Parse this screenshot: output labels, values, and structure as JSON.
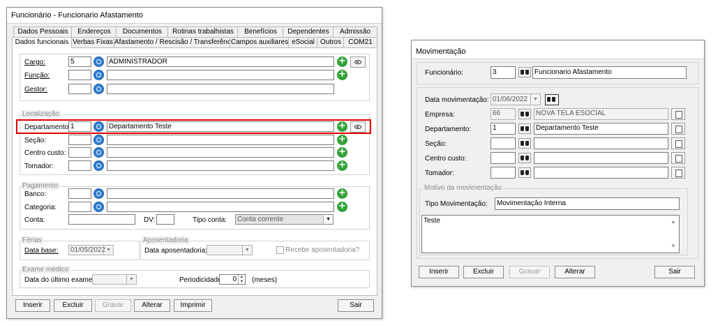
{
  "left_window": {
    "title": "Funcionário - Funcionario Afastamento",
    "tabs_row1": [
      "Dados Pessoais",
      "Endereços",
      "Documentos",
      "Rotinas trabalhistas",
      "Benefícios",
      "Dependentes",
      "Admissão"
    ],
    "tabs_row2": [
      "Dados funcionais",
      "Verbas Fixas",
      "Afastamento / Rescisão / Transferência",
      "Campos auxiliares",
      "eSocial",
      "Outros",
      "COM21"
    ],
    "active_tab": "Dados funcionais",
    "cargo": {
      "label": "Cargo:",
      "code": "5",
      "desc": "ADMINISTRADOR"
    },
    "funcao": {
      "label": "Função:",
      "code": "",
      "desc": ""
    },
    "gestor": {
      "label": "Gestor:",
      "code": "",
      "desc": ""
    },
    "localizacao": {
      "title": "Localização",
      "departamento": {
        "label": "Departamento:",
        "code": "1",
        "desc": "Departamento Teste"
      },
      "secao": {
        "label": "Seção:",
        "code": "",
        "desc": ""
      },
      "centro_custo": {
        "label": "Centro custo:",
        "code": "",
        "desc": ""
      },
      "tomador": {
        "label": "Tomador:",
        "code": "",
        "desc": ""
      }
    },
    "pagamento": {
      "title": "Pagamento",
      "banco": {
        "label": "Banco:",
        "code": "",
        "desc": ""
      },
      "categoria": {
        "label": "Categoria:",
        "code": "",
        "desc": ""
      },
      "conta_label": "Conta:",
      "conta": "",
      "dv_label": "DV:",
      "dv": "",
      "tipo_conta_label": "Tipo conta:",
      "tipo_conta": "Conta corrente"
    },
    "ferias": {
      "title": "Férias",
      "data_base_label": "Data base:",
      "data_base": "01/05/2022"
    },
    "aposentadoria": {
      "title": "Aposentadoria",
      "data_label": "Data aposentadoria:",
      "data": "",
      "recebe_label": "Recebe aposentadoria?"
    },
    "exame": {
      "title": "Exame médico",
      "ultimo_label": "Data do último exame:",
      "ultimo": "",
      "periodicidade_label": "Periodicidade:",
      "periodicidade": "0",
      "meses_label": "(meses)"
    },
    "buttons": {
      "inserir": "Inserir",
      "excluir": "Excluir",
      "gravar": "Gravar",
      "alterar": "Alterar",
      "imprimir": "Imprimir",
      "sair": "Sair"
    }
  },
  "right_window": {
    "title": "Movimentação",
    "funcionario": {
      "label": "Funcionário:",
      "code": "3",
      "desc": "Funcionario Afastamento"
    },
    "data_mov": {
      "label": "Data movimentação:",
      "value": "01/06/2022"
    },
    "empresa": {
      "label": "Empresa:",
      "code": "66",
      "desc": "NOVA TELA ESOCIAL"
    },
    "departamento": {
      "label": "Departamento:",
      "code": "1",
      "desc": "Departamento Teste"
    },
    "secao": {
      "label": "Seção:",
      "code": "",
      "desc": ""
    },
    "centro_custo": {
      "label": "Centro custo:",
      "code": "",
      "desc": ""
    },
    "tomador": {
      "label": "Tomador:",
      "code": "",
      "desc": ""
    },
    "motivo": {
      "title": "Motivo da movimentação",
      "tipo_label": "Tipo Movimentação:",
      "tipo": "Movimentação Interna",
      "obs": "Teste"
    },
    "buttons": {
      "inserir": "Inserir",
      "excluir": "Excluir",
      "gravar": "Gravar",
      "alterar": "Alterar",
      "sair": "Sair"
    }
  }
}
